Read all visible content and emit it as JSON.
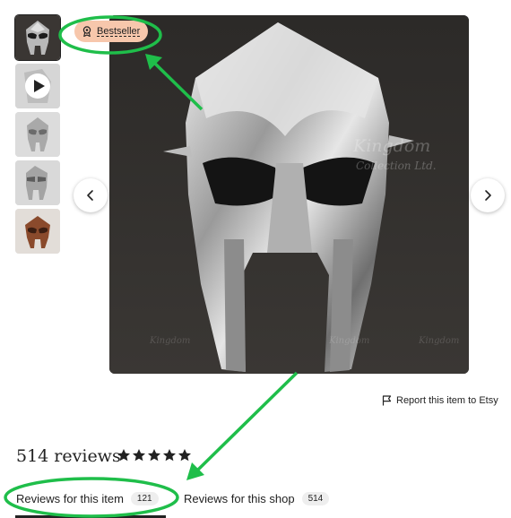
{
  "listing": {
    "badge": {
      "label": "Bestseller",
      "icon": "award-icon"
    },
    "report_link": "Report this item to Etsy",
    "watermark": {
      "line1": "Kingdom",
      "line2": "Collection Ltd."
    }
  },
  "thumbnails": [
    {
      "kind": "image",
      "subject": "chrome mask"
    },
    {
      "kind": "video",
      "icon": "play-icon"
    },
    {
      "kind": "image",
      "subject": "silver mask front"
    },
    {
      "kind": "image",
      "subject": "silver mask side"
    },
    {
      "kind": "image",
      "subject": "copper mask"
    }
  ],
  "reviews": {
    "count_label": "514 reviews",
    "rating": 5,
    "tabs": [
      {
        "label": "Reviews for this item",
        "count": "121",
        "active": true
      },
      {
        "label": "Reviews for this shop",
        "count": "514",
        "active": false
      }
    ]
  },
  "annotations": {
    "color": "#1fbe4a"
  }
}
